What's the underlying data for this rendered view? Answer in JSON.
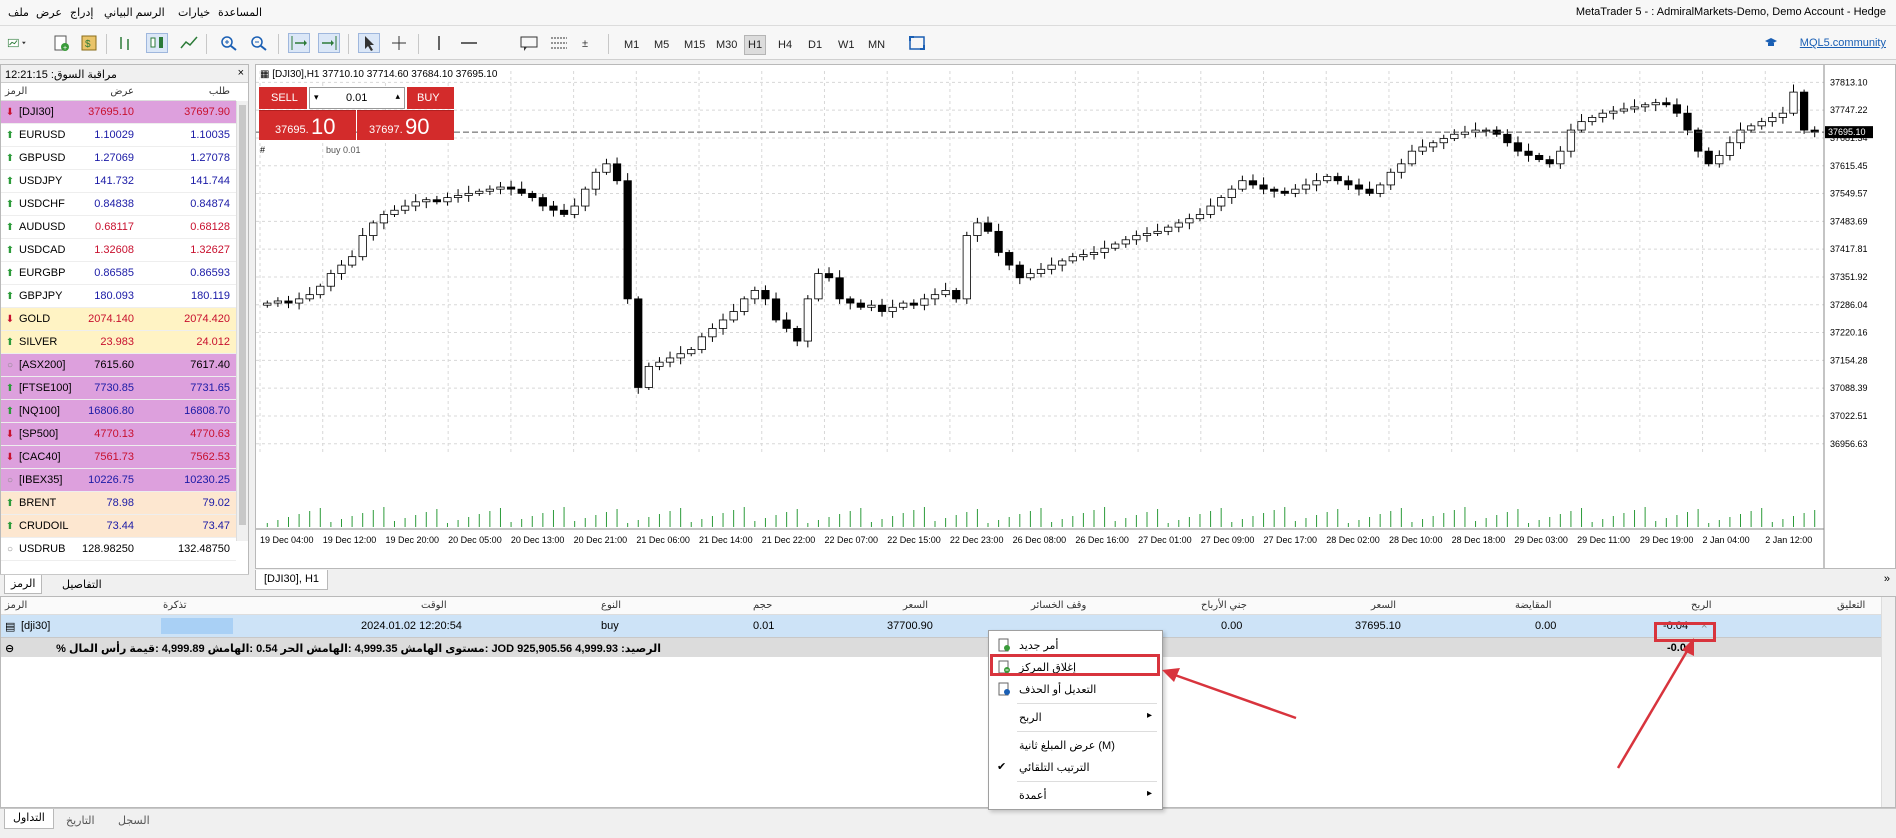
{
  "menubar": {
    "items": [
      "ملف",
      "عرض",
      "إدراج",
      "الرسم البياني",
      "خيارات",
      "المساعدة"
    ],
    "window_title": "MetaTrader 5 -            : AdmiralMarkets-Demo, Demo Account - Hedge"
  },
  "toolbar": {
    "timeframes": [
      "M1",
      "M5",
      "M15",
      "M30",
      "H1",
      "H4",
      "D1",
      "W1",
      "MN"
    ],
    "active_timeframe": "H1",
    "mql5_label": "MQL5.community"
  },
  "market_watch": {
    "title": "مراقبة السوق: 12:21:15",
    "close_label": "×",
    "col_symbol": "الرمز",
    "col_bid": "عرض",
    "col_ask": "طلب",
    "rows": [
      {
        "symbol": "[DJI30]",
        "bid": "37695.10",
        "ask": "37697.90",
        "dir": "down",
        "bg": "#dda0dd",
        "color": "#c8102e"
      },
      {
        "symbol": "EURUSD",
        "bid": "1.10029",
        "ask": "1.10035",
        "dir": "up",
        "bg": "#ffffff",
        "color": "#1a1aa6"
      },
      {
        "symbol": "GBPUSD",
        "bid": "1.27069",
        "ask": "1.27078",
        "dir": "up",
        "bg": "#ffffff",
        "color": "#1a1aa6"
      },
      {
        "symbol": "USDJPY",
        "bid": "141.732",
        "ask": "141.744",
        "dir": "up",
        "bg": "#ffffff",
        "color": "#1a1aa6"
      },
      {
        "symbol": "USDCHF",
        "bid": "0.84838",
        "ask": "0.84874",
        "dir": "up",
        "bg": "#ffffff",
        "color": "#1a1aa6"
      },
      {
        "symbol": "AUDUSD",
        "bid": "0.68117",
        "ask": "0.68128",
        "dir": "up",
        "bg": "#ffffff",
        "color": "#c8102e"
      },
      {
        "symbol": "USDCAD",
        "bid": "1.32608",
        "ask": "1.32627",
        "dir": "up",
        "bg": "#ffffff",
        "color": "#c8102e"
      },
      {
        "symbol": "EURGBP",
        "bid": "0.86585",
        "ask": "0.86593",
        "dir": "up",
        "bg": "#ffffff",
        "color": "#1a1aa6"
      },
      {
        "symbol": "GBPJPY",
        "bid": "180.093",
        "ask": "180.119",
        "dir": "up",
        "bg": "#ffffff",
        "color": "#1a1aa6"
      },
      {
        "symbol": "GOLD",
        "bid": "2074.140",
        "ask": "2074.420",
        "dir": "down",
        "bg": "#fff3c4",
        "color": "#c8102e"
      },
      {
        "symbol": "SILVER",
        "bid": "23.983",
        "ask": "24.012",
        "dir": "up",
        "bg": "#fff3c4",
        "color": "#c8102e"
      },
      {
        "symbol": "[ASX200]",
        "bid": "7615.60",
        "ask": "7617.40",
        "dir": "neutral",
        "bg": "#dda0dd",
        "color": "#000000"
      },
      {
        "symbol": "[FTSE100]",
        "bid": "7730.85",
        "ask": "7731.65",
        "dir": "up",
        "bg": "#dda0dd",
        "color": "#1a1aa6"
      },
      {
        "symbol": "[NQ100]",
        "bid": "16806.80",
        "ask": "16808.70",
        "dir": "up",
        "bg": "#dda0dd",
        "color": "#1a1aa6"
      },
      {
        "symbol": "[SP500]",
        "bid": "4770.13",
        "ask": "4770.63",
        "dir": "down",
        "bg": "#dda0dd",
        "color": "#c8102e"
      },
      {
        "symbol": "[CAC40]",
        "bid": "7561.73",
        "ask": "7562.53",
        "dir": "down",
        "bg": "#dda0dd",
        "color": "#c8102e"
      },
      {
        "symbol": "[IBEX35]",
        "bid": "10226.75",
        "ask": "10230.25",
        "dir": "neutral",
        "bg": "#dda0dd",
        "color": "#1a1aa6"
      },
      {
        "symbol": "BRENT",
        "bid": "78.98",
        "ask": "79.02",
        "dir": "up",
        "bg": "#fde7d0",
        "color": "#1a1aa6"
      },
      {
        "symbol": "CRUDOIL",
        "bid": "73.44",
        "ask": "73.47",
        "dir": "up",
        "bg": "#fde7d0",
        "color": "#1a1aa6"
      },
      {
        "symbol": "USDRUB",
        "bid": "128.98250",
        "ask": "132.48750",
        "dir": "neutral",
        "bg": "#ffffff",
        "color": "#000000"
      }
    ],
    "tabs": [
      "الرمز",
      "التفاصيل"
    ]
  },
  "chart": {
    "header": "[DJI30],H1  37710.10 37714.60 37684.10 37695.10",
    "trade_panel": {
      "sell_label": "SELL",
      "buy_label": "BUY",
      "lot": "0.01",
      "sell_price_small": "37695.",
      "sell_price_big": "10",
      "buy_price_small": "37697.",
      "buy_price_big": "90",
      "position_line_label": "buy 0.01",
      "hash_label": "#"
    },
    "tab_label": "[DJI30], H1",
    "expand_label": "»",
    "current_price_label": "37695.10",
    "y_labels": [
      "37813.10",
      "37747.22",
      "37681.34",
      "37615.45",
      "37549.57",
      "37483.69",
      "37417.81",
      "37351.92",
      "37286.04",
      "37220.16",
      "37154.28",
      "37088.39",
      "37022.51",
      "36956.63"
    ],
    "x_labels": [
      "19 Dec 04:00",
      "19 Dec 12:00",
      "19 Dec 20:00",
      "20 Dec 05:00",
      "20 Dec 13:00",
      "20 Dec 21:00",
      "21 Dec 06:00",
      "21 Dec 14:00",
      "21 Dec 22:00",
      "22 Dec 07:00",
      "22 Dec 15:00",
      "22 Dec 23:00",
      "26 Dec 08:00",
      "26 Dec 16:00",
      "27 Dec 01:00",
      "27 Dec 09:00",
      "27 Dec 17:00",
      "28 Dec 02:00",
      "28 Dec 10:00",
      "28 Dec 18:00",
      "29 Dec 03:00",
      "29 Dec 11:00",
      "29 Dec 19:00",
      "2 Jan 04:00",
      "2 Jan 12:00"
    ]
  },
  "toolbox": {
    "columns": [
      "الرمز",
      "تذكرة",
      "الوقت",
      "النوع",
      "حجم",
      "السعر",
      "وقف الخسائر",
      "جني الأرباح",
      "السعر",
      "المقايضة",
      "الربح",
      "التعليق"
    ],
    "position": {
      "symbol": "[dji30]",
      "time": "2024.01.02 12:20:54",
      "type": "buy",
      "volume": "0.01",
      "open_price": "37700.90",
      "sl": "0.00",
      "tp": "0.00",
      "price": "37695.10",
      "swap": "0.00",
      "profit": "-0.04",
      "close_x": "×"
    },
    "balance_text": "الرصيد: 4,999.93 JOD  925,905.56 :مستوى الهامش  4,999.35 :الهامش الحر  0.54 :الهامش  4,999.89 :قيمة رأس المال %",
    "balance_profit": "-0.04",
    "tabs": [
      "التداول",
      "التاريخ",
      "السجل"
    ]
  },
  "context_menu": {
    "items": [
      {
        "label": "أمر جديد",
        "icon": "new-order-icon",
        "submenu": false
      },
      {
        "label": "إغلاق المركز",
        "icon": "close-position-icon",
        "submenu": false
      },
      {
        "label": "التعديل أو الحذف",
        "icon": "modify-icon",
        "submenu": false
      },
      {
        "label": "الربح",
        "icon": "",
        "submenu": true
      },
      {
        "label": "عرض المبلغ ثانية (M)",
        "icon": "",
        "submenu": false
      },
      {
        "label": "الترتيب التلقائي",
        "icon": "check-icon",
        "submenu": false
      },
      {
        "label": "أعمدة",
        "icon": "",
        "submenu": true
      }
    ],
    "submenu_arrow": "▸",
    "check_glyph": "✔"
  },
  "colors": {
    "highlight": "#d8343d",
    "sell_red": "#d32b2b",
    "selected_row": "#cde3f7"
  },
  "chart_data": {
    "type": "candlestick",
    "symbol": "[DJI30]",
    "timeframe": "H1",
    "ylim": [
      36930,
      37840
    ],
    "current_price": 37695.1,
    "closes": [
      37290,
      37295,
      37290,
      37300,
      37310,
      37330,
      37360,
      37380,
      37400,
      37450,
      37480,
      37500,
      37510,
      37520,
      37530,
      37535,
      37530,
      37540,
      37545,
      37550,
      37555,
      37560,
      37565,
      37560,
      37550,
      37540,
      37520,
      37510,
      37500,
      37520,
      37560,
      37600,
      37620,
      37580,
      37300,
      37090,
      37140,
      37150,
      37160,
      37170,
      37180,
      37210,
      37230,
      37250,
      37270,
      37300,
      37320,
      37300,
      37250,
      37230,
      37200,
      37300,
      37360,
      37350,
      37300,
      37290,
      37280,
      37285,
      37270,
      37280,
      37290,
      37285,
      37300,
      37310,
      37320,
      37300,
      37450,
      37480,
      37460,
      37410,
      37380,
      37350,
      37360,
      37370,
      37380,
      37390,
      37400,
      37405,
      37410,
      37420,
      37430,
      37440,
      37450,
      37455,
      37460,
      37470,
      37480,
      37490,
      37500,
      37520,
      37540,
      37560,
      37580,
      37570,
      37560,
      37555,
      37550,
      37560,
      37570,
      37580,
      37590,
      37580,
      37570,
      37560,
      37550,
      37570,
      37600,
      37620,
      37650,
      37660,
      37670,
      37680,
      37690,
      37695,
      37700,
      37700,
      37690,
      37670,
      37650,
      37640,
      37630,
      37620,
      37650,
      37700,
      37720,
      37730,
      37740,
      37745,
      37750,
      37755,
      37760,
      37765,
      37760,
      37740,
      37700,
      37650,
      37620,
      37640,
      37670,
      37700,
      37710,
      37720,
      37730,
      37740,
      37790,
      37700,
      37695
    ]
  }
}
